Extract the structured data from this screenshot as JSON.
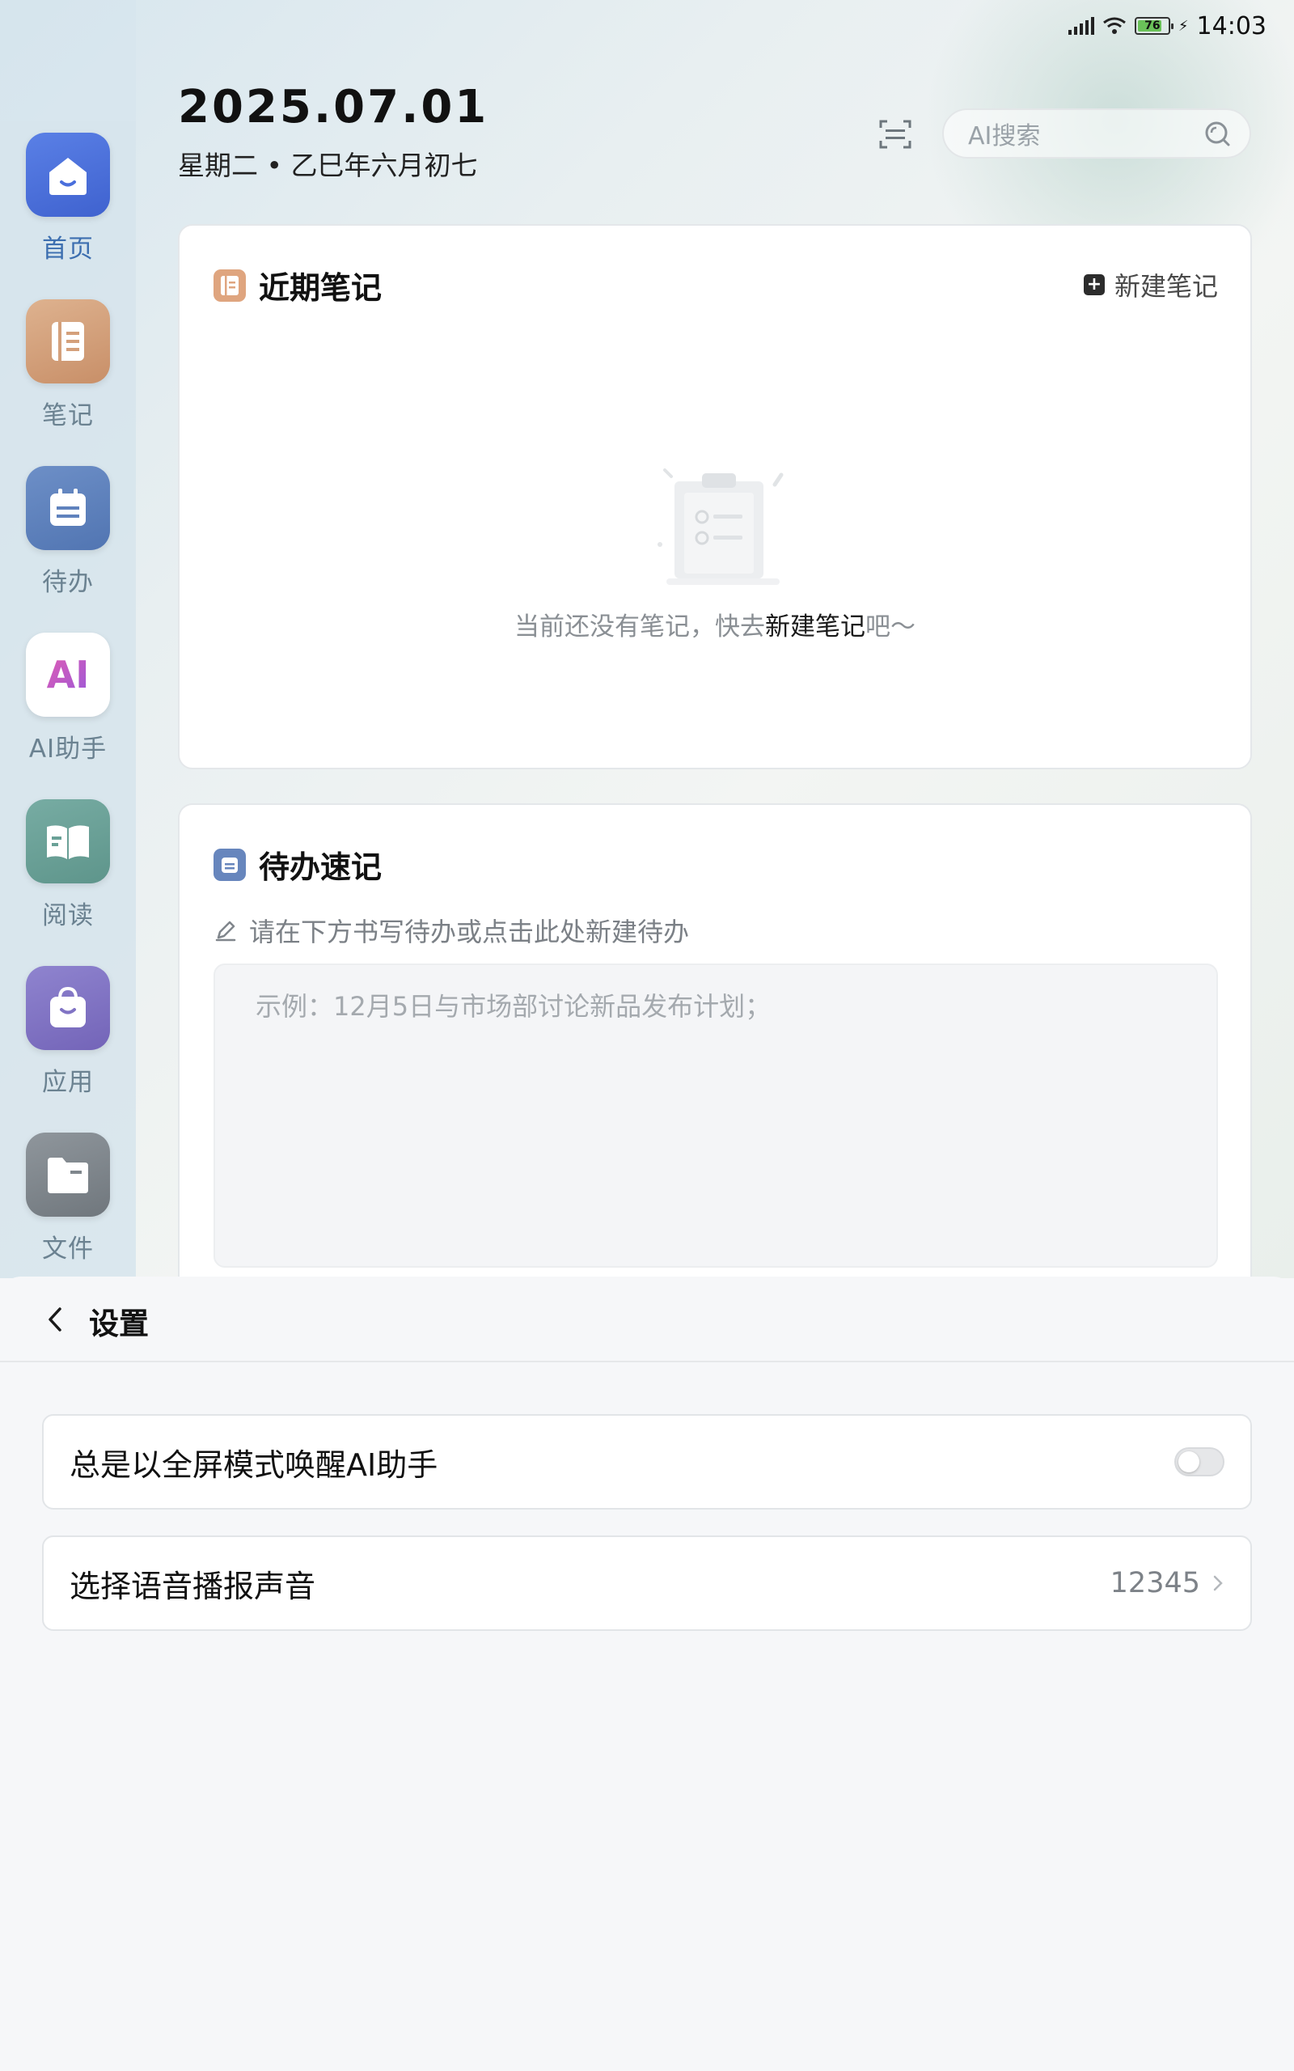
{
  "status_bar": {
    "time": "14:03",
    "battery": "76",
    "icons": [
      "signal-icon",
      "wifi-icon",
      "battery-icon",
      "charging-icon"
    ]
  },
  "sidebar": {
    "items": [
      {
        "label": "首页",
        "icon": "home-icon",
        "color": "#4a6fdc",
        "active": true
      },
      {
        "label": "笔记",
        "icon": "notebook-icon",
        "color": "#d4a07b"
      },
      {
        "label": "待办",
        "icon": "todo-icon",
        "color": "#5f82bd"
      },
      {
        "label": "AI助手",
        "icon": "ai-assistant-icon",
        "icon_text": "AI",
        "color": "#ffffff"
      },
      {
        "label": "阅读",
        "icon": "book-icon",
        "color": "#6aa197"
      },
      {
        "label": "应用",
        "icon": "bag-icon",
        "color": "#8174c4"
      },
      {
        "label": "文件",
        "icon": "folder-icon",
        "color": "#80878d"
      }
    ]
  },
  "header": {
    "date": "2025.07.01",
    "lunar": "星期二 • 乙巳年六月初七",
    "search_placeholder": "AI搜索"
  },
  "recent_notes": {
    "title": "近期笔记",
    "new_label": "新建笔记",
    "empty_prefix": "当前还没有笔记，快去",
    "empty_link": "新建笔记",
    "empty_suffix": "吧～"
  },
  "todo_quick": {
    "title": "待办速记",
    "hint": "请在下方书写待办或点击此处新建待办",
    "placeholder": "示例：12月5日与市场部讨论新品发布计划；"
  },
  "settings": {
    "title": "设置",
    "rows": [
      {
        "label": "总是以全屏模式唤醒AI助手",
        "toggle_on": false
      },
      {
        "label": "选择语音播报声音",
        "value": "12345"
      }
    ]
  },
  "colors": {
    "accent": "#4a6fdc",
    "background": "#f6f7f9",
    "card": "#ffffff"
  }
}
